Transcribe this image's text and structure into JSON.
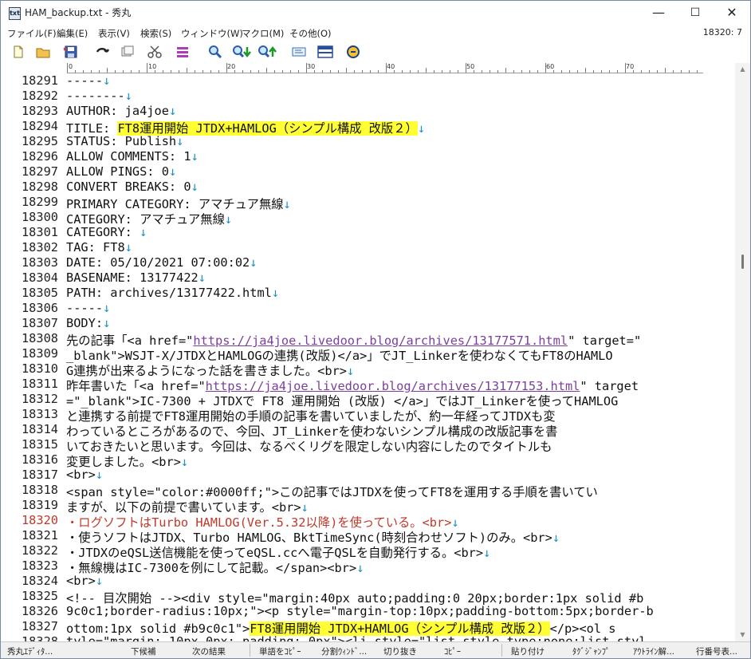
{
  "window": {
    "title": "HAM_backup.txt - 秀丸",
    "app_icon_glyph": "txt",
    "minimize_glyph": "—",
    "maximize_glyph": "☐",
    "close_glyph": "✕"
  },
  "menu": {
    "items": [
      "ファイル(F)",
      "編集(E)",
      "表示(V)",
      "検索(S)",
      "ウィンドウ(W)",
      "マクロ(M)",
      "その他(O)"
    ],
    "position": "18320: 7"
  },
  "toolbar": {
    "buttons": [
      "new-file-icon",
      "open-folder-icon",
      "save-icon",
      "undo-icon",
      "copy-icon",
      "cut-icon",
      "paste-icon",
      "find-icon",
      "find-down-icon",
      "find-up-icon",
      "grep-icon",
      "split-window-icon",
      "hide-icon"
    ]
  },
  "ruler": {
    "labels": [
      "0",
      "10",
      "20",
      "30",
      "40",
      "50",
      "60",
      "70"
    ]
  },
  "editor": {
    "current_line": 18320,
    "lines": [
      {
        "num": "18291",
        "segs": [
          {
            "t": "-----"
          }
        ],
        "eol": "↓"
      },
      {
        "num": "18292",
        "segs": [
          {
            "t": "--------"
          }
        ],
        "eol": "↓"
      },
      {
        "num": "18293",
        "segs": [
          {
            "t": "AUTHOR: ja4joe"
          }
        ],
        "eol": "↓"
      },
      {
        "num": "18294",
        "segs": [
          {
            "t": "TITLE: "
          },
          {
            "t": "FT8運用開始 JTDX+HAMLOG（シンプル構成 改版２）",
            "s": "hl"
          }
        ],
        "eol": "↓"
      },
      {
        "num": "18295",
        "segs": [
          {
            "t": "STATUS: Publish"
          }
        ],
        "eol": "↓"
      },
      {
        "num": "18296",
        "segs": [
          {
            "t": "ALLOW COMMENTS: 1"
          }
        ],
        "eol": "↓"
      },
      {
        "num": "18297",
        "segs": [
          {
            "t": "ALLOW PINGS: 0"
          }
        ],
        "eol": "↓"
      },
      {
        "num": "18298",
        "segs": [
          {
            "t": "CONVERT BREAKS: 0"
          }
        ],
        "eol": "↓"
      },
      {
        "num": "18299",
        "segs": [
          {
            "t": "PRIMARY CATEGORY: アマチュア無線"
          }
        ],
        "eol": "↓"
      },
      {
        "num": "18300",
        "segs": [
          {
            "t": "CATEGORY: アマチュア無線"
          }
        ],
        "eol": "↓"
      },
      {
        "num": "18301",
        "segs": [
          {
            "t": "CATEGORY: "
          }
        ],
        "eol": "↓"
      },
      {
        "num": "18302",
        "segs": [
          {
            "t": "TAG: FT8"
          }
        ],
        "eol": "↓"
      },
      {
        "num": "18303",
        "segs": [
          {
            "t": "DATE: 05/10/2021 07:00:02"
          }
        ],
        "eol": "↓"
      },
      {
        "num": "18304",
        "segs": [
          {
            "t": "BASENAME: 13177422"
          }
        ],
        "eol": "↓"
      },
      {
        "num": "18305",
        "segs": [
          {
            "t": "PATH: archives/13177422.html"
          }
        ],
        "eol": "↓"
      },
      {
        "num": "18306",
        "segs": [
          {
            "t": "-----"
          }
        ],
        "eol": "↓"
      },
      {
        "num": "18307",
        "segs": [
          {
            "t": "BODY:"
          }
        ],
        "eol": "↓"
      },
      {
        "num": "18308",
        "segs": [
          {
            "t": "先の記事「<a href=\""
          },
          {
            "t": "https://ja4joe.livedoor.blog/archives/13177571.html",
            "s": "link"
          },
          {
            "t": "\" target=\""
          }
        ],
        "eol": ""
      },
      {
        "num": "18309",
        "segs": [
          {
            "t": "_blank\">WSJT-X/JTDXとHAMLOGの連携(改版)</a>」でJT_Linkerを使わなくてもFT8のHAMLO"
          }
        ],
        "eol": ""
      },
      {
        "num": "18310",
        "segs": [
          {
            "t": "G連携が出来るようになった話を書きました。<br>"
          }
        ],
        "eol": "↓"
      },
      {
        "num": "18311",
        "segs": [
          {
            "t": "昨年書いた「<a href=\""
          },
          {
            "t": "https://ja4joe.livedoor.blog/archives/13177153.html",
            "s": "link"
          },
          {
            "t": "\" target"
          }
        ],
        "eol": ""
      },
      {
        "num": "18312",
        "segs": [
          {
            "t": "=\"_blank\">IC-7300 + JTDXで FT8 運用開始 (改版) </a>」ではJT_Linkerを使ってHAMLOG"
          }
        ],
        "eol": ""
      },
      {
        "num": "18313",
        "segs": [
          {
            "t": "と連携する前提でFT8運用開始の手順の記事を書いていましたが、約一年経ってJTDXも変"
          }
        ],
        "eol": ""
      },
      {
        "num": "18314",
        "segs": [
          {
            "t": "わっているところがあるので、今回、JT_Linkerを使わないシンプル構成の改版記事を書"
          }
        ],
        "eol": ""
      },
      {
        "num": "18315",
        "segs": [
          {
            "t": "いておきたいと思います。今回は、なるべくリグを限定しない内容にしたのでタイトルも"
          }
        ],
        "eol": ""
      },
      {
        "num": "18316",
        "segs": [
          {
            "t": "変更しました。<br>"
          }
        ],
        "eol": "↓"
      },
      {
        "num": "18317",
        "segs": [
          {
            "t": "<br>"
          }
        ],
        "eol": "↓"
      },
      {
        "num": "18318",
        "segs": [
          {
            "t": "<span style=\"color:#0000ff;\">この記事ではJTDXを使ってFT8を運用する手順を書いてい"
          }
        ],
        "eol": ""
      },
      {
        "num": "18319",
        "segs": [
          {
            "t": "ますが、以下の前提で書いています。<br>"
          }
        ],
        "eol": "↓"
      },
      {
        "num": "18320",
        "segs": [
          {
            "t": "・ログソフトはTurbo HAMLOG(Ver.5.32以降)を使っている。<br>"
          }
        ],
        "eol": "↓"
      },
      {
        "num": "18321",
        "segs": [
          {
            "t": "・使うソフトはJTDX、Turbo HAMLOG、BktTimeSync(時刻合わせソフト)のみ。<br>"
          }
        ],
        "eol": "↓"
      },
      {
        "num": "18322",
        "segs": [
          {
            "t": "・JTDXのeQSL送信機能を使ってeQSL.ccへ電子QSLを自動発行する。<br>"
          }
        ],
        "eol": "↓"
      },
      {
        "num": "18323",
        "segs": [
          {
            "t": "・無線機はIC-7300を例にして記載。</span><br>"
          }
        ],
        "eol": "↓"
      },
      {
        "num": "18324",
        "segs": [
          {
            "t": "<br>"
          }
        ],
        "eol": "↓"
      },
      {
        "num": "18325",
        "segs": [
          {
            "t": "<!-- 目次開始 --><div style=\"margin:40px auto;padding:0 20px;border:1px solid #b"
          }
        ],
        "eol": ""
      },
      {
        "num": "18326",
        "segs": [
          {
            "t": "9c0c1;border-radius:10px;\"><p style=\"margin-top:10px;padding-bottom:5px;border-b"
          }
        ],
        "eol": ""
      },
      {
        "num": "18327",
        "segs": [
          {
            "t": "ottom:1px solid #b9c0c1\">"
          },
          {
            "t": "FT8運用開始 JTDX+HAMLOG（シンプル構成 改版２）",
            "s": "hl"
          },
          {
            "t": "</p><ol s"
          }
        ],
        "eol": ""
      },
      {
        "num": "18328",
        "segs": [
          {
            "t": "tyle=\"margin: 10px 0px; padding: 0px\"><li style=\"list-style-type:none;list-styl"
          }
        ],
        "eol": ""
      }
    ]
  },
  "statusbar": {
    "keys": [
      "秀丸ｴﾃﾞｨﾀ...",
      "下候補",
      "次の結果",
      "単語をｺﾋﾟｰ",
      "分割ｳｨﾝﾄﾞ...",
      "切り抜き",
      "ｺﾋﾟｰ",
      "貼り付け",
      "ﾀｸﾞｼﾞｬﾝﾌﾟ",
      "ｱｳﾄﾗｲﾝ解...",
      "行番号表..."
    ]
  }
}
